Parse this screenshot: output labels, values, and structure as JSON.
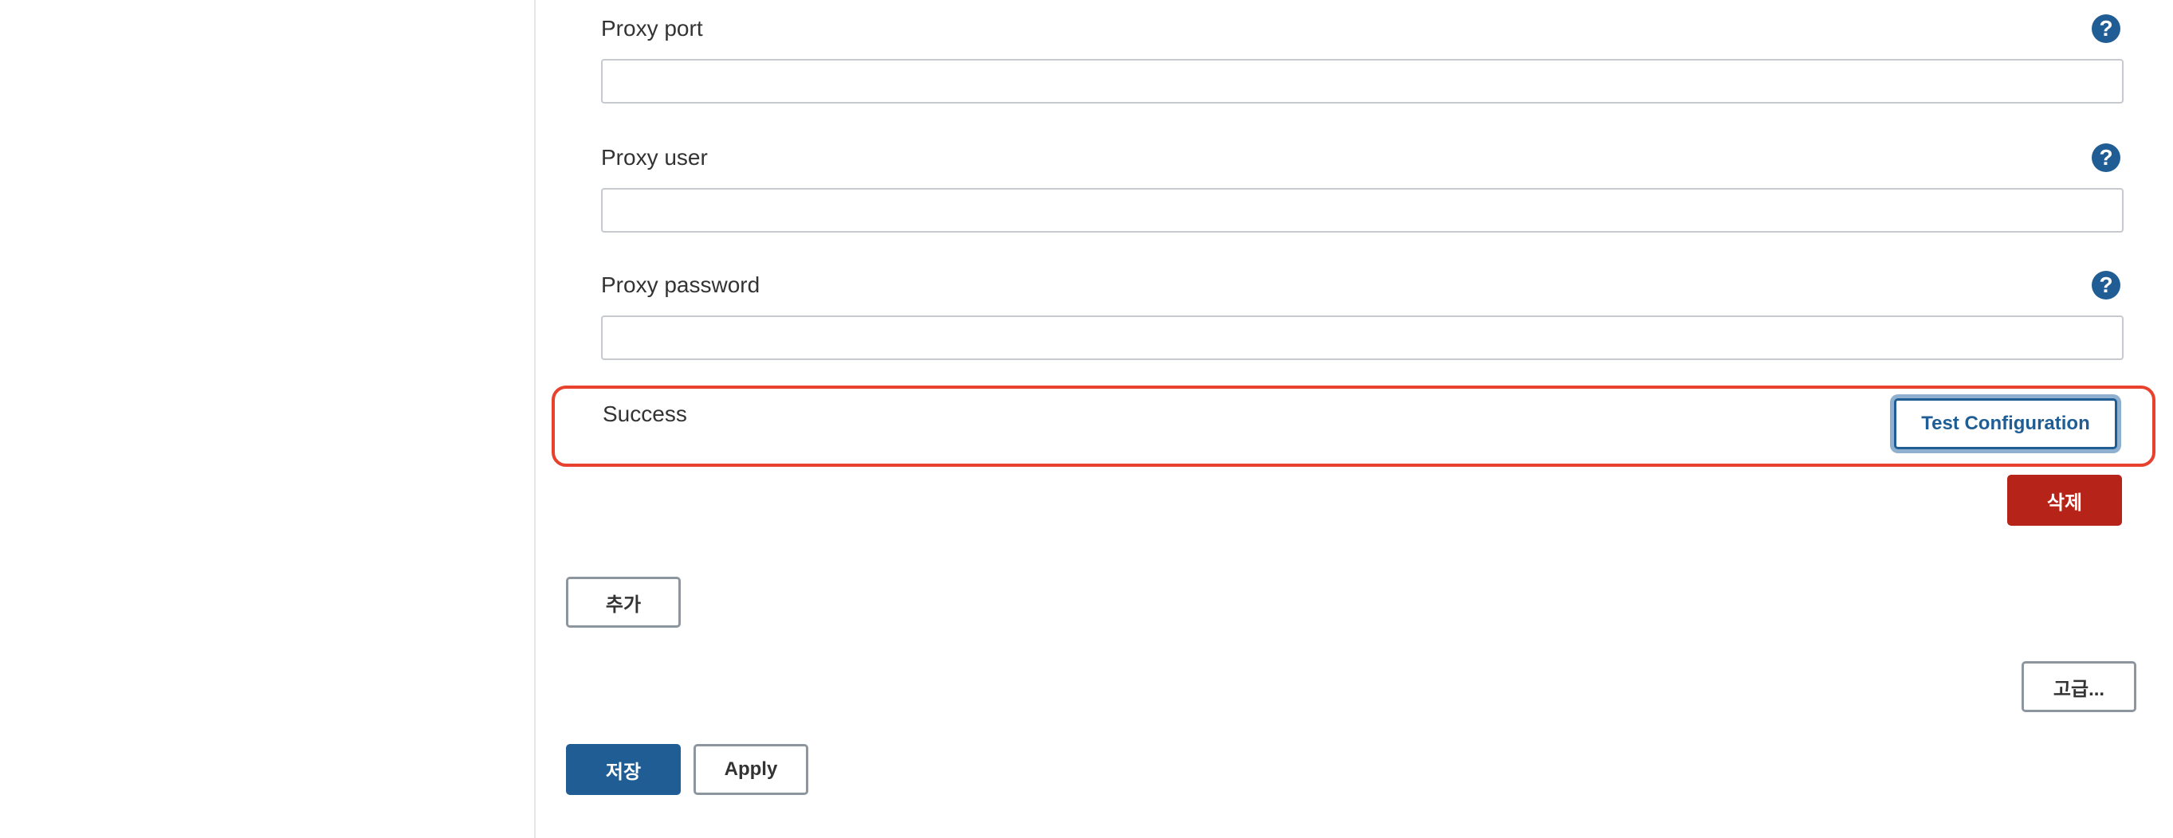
{
  "form": {
    "fields": [
      {
        "label": "Proxy port",
        "value": "",
        "help_icon": "question-mark-circle"
      },
      {
        "label": "Proxy user",
        "value": "",
        "help_icon": "question-mark-circle"
      },
      {
        "label": "Proxy password",
        "value": "",
        "help_icon": "question-mark-circle"
      }
    ],
    "help_glyph": "?",
    "status_text": "Success",
    "test_configuration_label": "Test Configuration",
    "delete_label": "삭제",
    "add_label": "추가",
    "advanced_label": "고급...",
    "save_label": "저장",
    "apply_label": "Apply"
  },
  "colors": {
    "primary": "#1f5d94",
    "danger": "#b52319",
    "highlight": "#e8412e",
    "focus_ring": "#8fb0cf"
  }
}
